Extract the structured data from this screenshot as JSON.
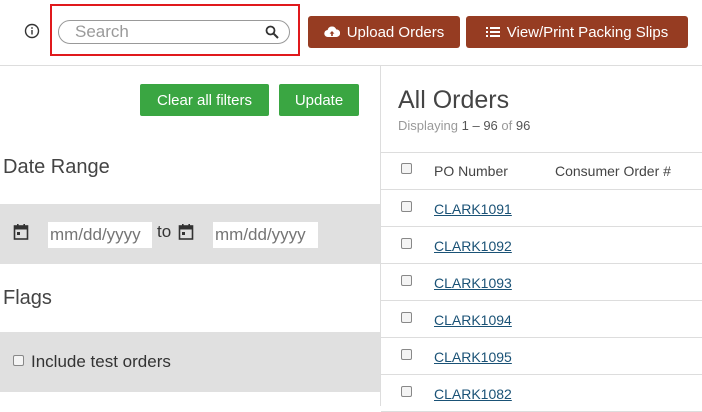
{
  "header": {
    "search_placeholder": "Search",
    "upload_label": "Upload Orders",
    "packing_label": "View/Print Packing Slips"
  },
  "filters": {
    "clear_label": "Clear all filters",
    "update_label": "Update",
    "date_range_title": "Date Range",
    "date_from_placeholder": "mm/dd/yyyy",
    "date_to_label": "to",
    "date_to_placeholder": "mm/dd/yyyy",
    "flags_title": "Flags",
    "include_test_label": "Include test orders"
  },
  "orders": {
    "title": "All Orders",
    "displaying_label": "Displaying",
    "range_start": "1",
    "range_sep": "–",
    "range_end": "96",
    "of_label": "of",
    "total": "96",
    "columns": [
      "PO Number",
      "Consumer Order #"
    ],
    "rows": [
      "CLARK1091",
      "CLARK1092",
      "CLARK1093",
      "CLARK1094",
      "CLARK1095",
      "CLARK1082"
    ]
  },
  "colors": {
    "brown_button": "#963c22",
    "green_button": "#3aa642",
    "highlight_border": "#e0191c",
    "link": "#1a5276"
  },
  "icons": [
    "info-icon",
    "search-icon",
    "cloud-upload-icon",
    "list-icon",
    "calendar-icon"
  ]
}
